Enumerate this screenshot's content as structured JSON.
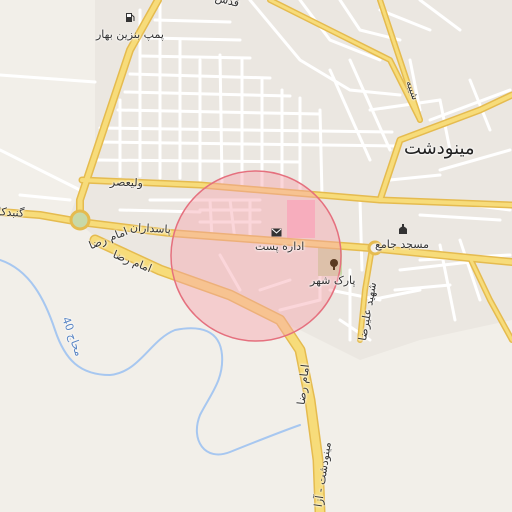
{
  "map": {
    "colors": {
      "background": "#f2efe9",
      "minor_road": "#ffffff",
      "major_road": "#f7dc7a",
      "major_road_casing": "#e5bb4f",
      "water": "#a7c7f0",
      "park": "#c8d9a8",
      "pink_area": "#f7b4cb",
      "circle_fill": "#f6a3ad",
      "circle_stroke": "#e5707e"
    },
    "circle": {
      "center_label": "اداره پست"
    },
    "labels": {
      "town": "مینودشت",
      "gas_station": "پمپ بنزین بهار",
      "post_office": "اداره پست",
      "mosque": "مسجد جامع",
      "park": "پارک شهر",
      "street_valiasr": "ولیعصر",
      "street_pasdaran": "پاسداران",
      "street_imam_reza": "امام رضا",
      "street_gonbad": "گنبدکا",
      "street_shahid_alireza": "شهید علیرضا",
      "street_minoodasht_road": "مینودشت - آزا",
      "street_imam_reza_south": "امام رضا",
      "street_top": "قدس",
      "street_top_right": "شیبه",
      "river": "محاج 40"
    },
    "icons": {
      "gas_station": "fuel-icon",
      "post_office": "envelope-icon",
      "mosque": "mosque-icon",
      "park": "tree-icon"
    }
  }
}
